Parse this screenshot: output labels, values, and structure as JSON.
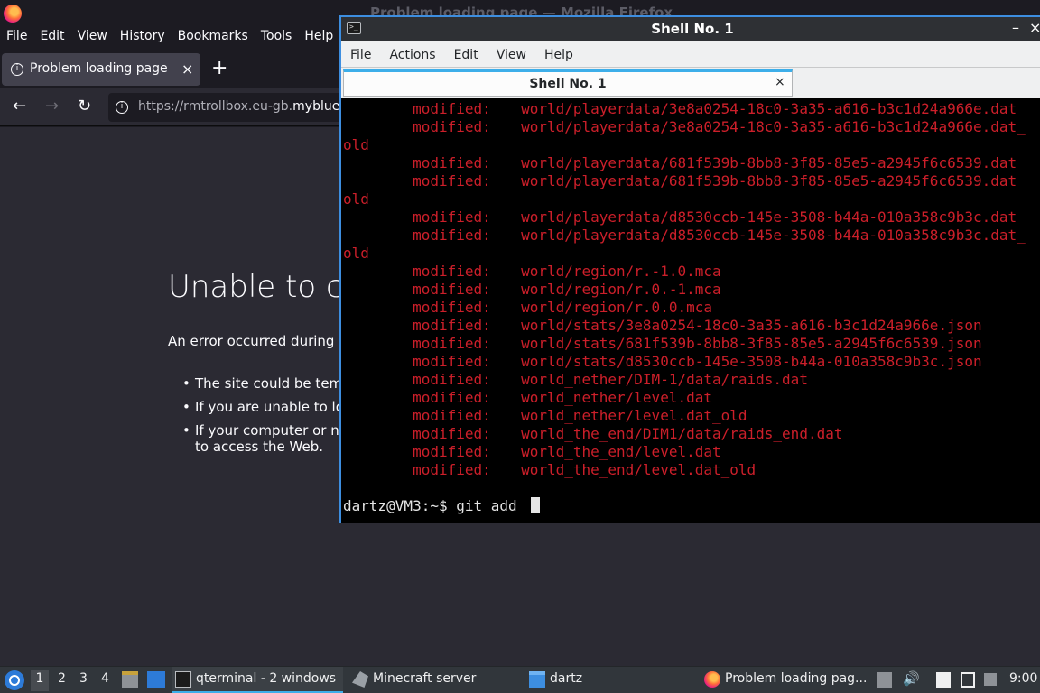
{
  "firefox": {
    "window_title": "Problem loading page — Mozilla Firefox",
    "menu": [
      "File",
      "Edit",
      "View",
      "History",
      "Bookmarks",
      "Tools",
      "Help"
    ],
    "tab_title": "Problem loading page",
    "tab_close": "×",
    "new_tab": "+",
    "url_prefix": "https://rmtrollbox.eu-gb.",
    "url_host": "myblue",
    "error_title": "Unable to c",
    "error_desc": "An error occurred during",
    "error_items": [
      "The site could be tem",
      "If you are unable to lo",
      "If your computer or n",
      "to access the Web."
    ]
  },
  "terminal": {
    "window_title": "Shell No. 1",
    "menu": [
      "File",
      "Actions",
      "Edit",
      "View",
      "Help"
    ],
    "tab_title": "Shell No. 1",
    "tab_close": "×",
    "status_word": "modified:",
    "lines": [
      "world/playerdata/3e8a0254-18c0-3a35-a616-b3c1d24a966e.dat",
      "world/playerdata/3e8a0254-18c0-3a35-a616-b3c1d24a966e.dat_",
      "old",
      "world/playerdata/681f539b-8bb8-3f85-85e5-a2945f6c6539.dat",
      "world/playerdata/681f539b-8bb8-3f85-85e5-a2945f6c6539.dat_",
      "old",
      "world/playerdata/d8530ccb-145e-3508-b44a-010a358c9b3c.dat",
      "world/playerdata/d8530ccb-145e-3508-b44a-010a358c9b3c.dat_",
      "old",
      "world/region/r.-1.0.mca",
      "world/region/r.0.-1.mca",
      "world/region/r.0.0.mca",
      "world/stats/3e8a0254-18c0-3a35-a616-b3c1d24a966e.json",
      "world/stats/681f539b-8bb8-3f85-85e5-a2945f6c6539.json",
      "world/stats/d8530ccb-145e-3508-b44a-010a358c9b3c.json",
      "world_nether/DIM-1/data/raids.dat",
      "world_nether/level.dat",
      "world_nether/level.dat_old",
      "world_the_end/DIM1/data/raids_end.dat",
      "world_the_end/level.dat",
      "world_the_end/level.dat_old"
    ],
    "prompt": "dartz@VM3:~$ git add "
  },
  "taskbar": {
    "workspaces": [
      "1",
      "2",
      "3",
      "4"
    ],
    "tasks": {
      "terminal": "qterminal - 2 windows",
      "minecraft": "Minecraft server",
      "dartz": "dartz",
      "firefox": "Problem loading pag..."
    },
    "clock": "9:00"
  }
}
